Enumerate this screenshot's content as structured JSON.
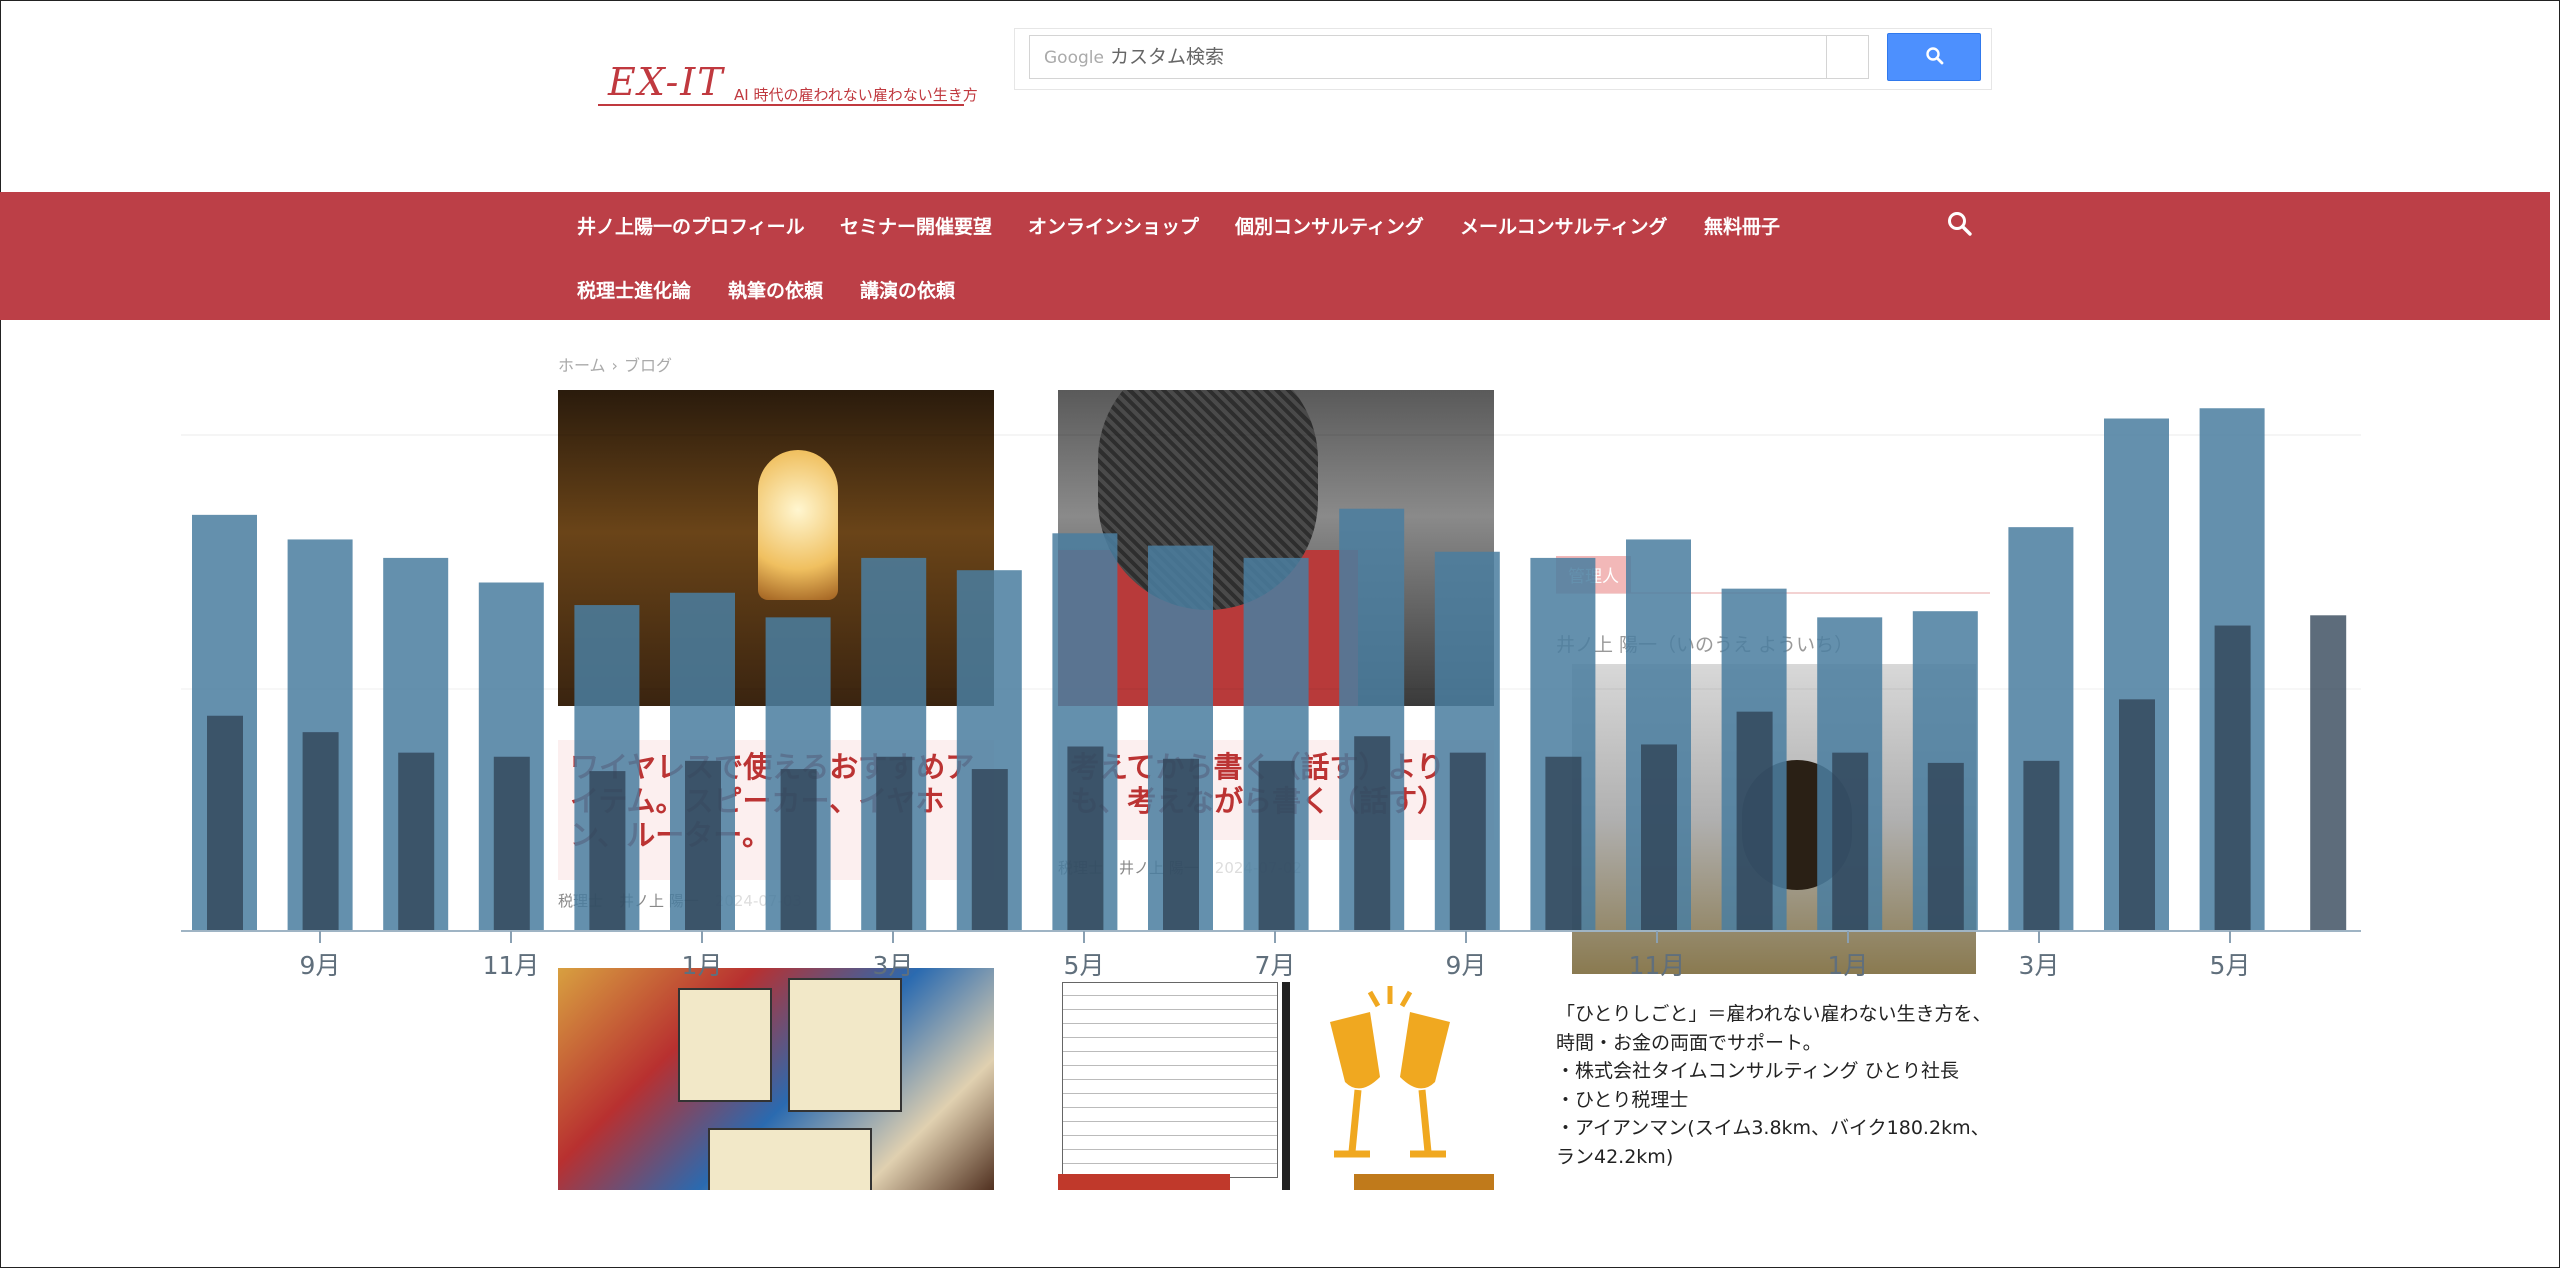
{
  "header": {
    "logo_main": "EX-IT",
    "logo_sub": "AI 時代の雇われない雇わない生き方",
    "search": {
      "provider_label": "Google",
      "placeholder": "カスタム検索",
      "button_icon": "search-icon"
    }
  },
  "nav": {
    "items": [
      "井ノ上陽一のプロフィール",
      "セミナー開催要望",
      "オンラインショップ",
      "個別コンサルティング",
      "メールコンサルティング",
      "無料冊子",
      "税理士進化論",
      "執筆の依頼",
      "講演の依頼"
    ],
    "search_icon": "search-icon"
  },
  "breadcrumb": {
    "home": "ホーム",
    "sep": "›",
    "current": "ブログ"
  },
  "posts": [
    {
      "title": "ワイヤレスで使えるおすすめアイテム。スピーカー、イヤホン、ルーター。",
      "category": "税理士",
      "author": "井ノ上 陽一",
      "date": "2024-07-03"
    },
    {
      "title": "考えてから書く（話す）よりも、考えながら書く（話す）",
      "category": "税理士",
      "author": "井ノ上 陽一",
      "date": "2024-07-02"
    }
  ],
  "sidebar": {
    "heading": "管理人",
    "name": "井ノ上 陽一（いのうえ よういち）",
    "bio": [
      "「ひとりしごと」＝雇われない雇わない生き方を、",
      "時間・お金の両面でサポート。",
      "・株式会社タイムコンサルティング ひとり社長",
      "・ひとり税理士",
      "・アイアンマン(スイム3.8km、バイク180.2km、",
      "ラン42.2km)"
    ]
  },
  "colors": {
    "brand_red": "#bc3f47",
    "bar_light": "#4a7ea0",
    "bar_dark": "#2f4256"
  },
  "chart_data": {
    "type": "bar",
    "tick_labels": [
      "9月",
      "11月",
      "1月",
      "3月",
      "5月",
      "7月",
      "9月",
      "11月",
      "1月",
      "3月",
      "5月"
    ],
    "ylim": [
      0,
      255
    ],
    "grid": false,
    "legend": "none",
    "series": [
      {
        "values": [
          203,
          191,
          182,
          170,
          159,
          165,
          153,
          182,
          176,
          194,
          188,
          182,
          206,
          185,
          182,
          191,
          167,
          153,
          156,
          197,
          250,
          255
        ]
      },
      {
        "values": [
          105,
          97,
          87,
          85,
          78,
          83,
          79,
          85,
          79,
          90,
          84,
          83,
          95,
          87,
          85,
          91,
          107,
          87,
          82,
          83,
          113,
          149,
          154
        ]
      }
    ]
  }
}
